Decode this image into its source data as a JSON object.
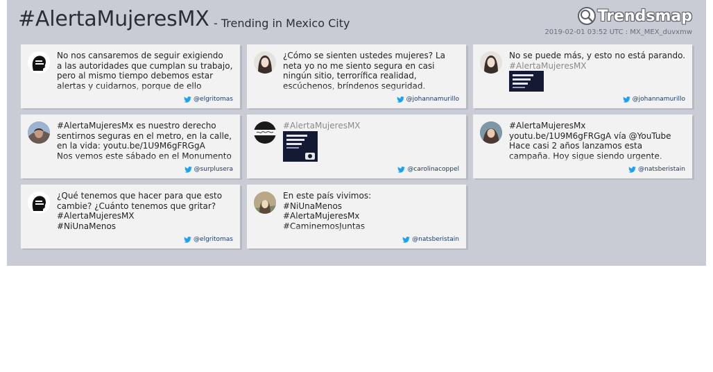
{
  "header": {
    "title": "#AlertaMujeresMX",
    "subtitle": "- Trending in Mexico City",
    "logo_text": "Trendsmap",
    "meta": "2019-02-01 03:52 UTC : MX_MEX_duvxmw"
  },
  "tweets": [
    {
      "lines": [
        "No nos cansaremos de seguir exigiendo",
        "a las autoridades que cumplan su trabajo,",
        "pero al mismo tiempo debemos estar",
        "alertas y cuidarnos, porque de ello"
      ],
      "user": "@elgritomas",
      "avatar_icon": "head-silhouette-icon"
    },
    {
      "lines": [
        "¿Cómo se sienten ustedes mujeres? La",
        "neta yo no me siento segura en casi",
        "ningún sitio, terrorífica realidad,",
        "escúchenos, bríndenos seguridad."
      ],
      "user": "@johannamurillo",
      "avatar_icon": "portrait-avatar"
    },
    {
      "lines": [
        "No se puede más, y esto no está parando.",
        "#AlertaMujeresMX"
      ],
      "user": "@johannamurillo",
      "avatar_icon": "portrait-avatar"
    },
    {
      "lines": [
        "#AlertaMujeresMx es nuestro derecho",
        "sentirnos seguras en el metro, en la calle,",
        "en la vida: youtu.be/1U9M6gFRGgA",
        "Nos vemos este sábado en el Monumento"
      ],
      "user": "@surplusera",
      "avatar_icon": "portrait-avatar"
    },
    {
      "lines": [
        "#AlertaMujeresMX"
      ],
      "user": "@carolinacoppel",
      "avatar_icon": "signature-avatar"
    },
    {
      "lines": [
        "#AlertaMujeresMx",
        "youtu.be/1U9M6gFRGgA vía @YouTube",
        "Hace casi 2 años lanzamos esta",
        "campaña. Hoy sigue siendo urgente."
      ],
      "user": "@natsberistain",
      "avatar_icon": "portrait-avatar"
    },
    {
      "lines": [
        "¿Qué tenemos que hacer para que esto",
        "cambie? ¿Cuánto tenemos que gritar?",
        "#AlertaMujeresMX",
        "#NiUnaMenos"
      ],
      "user": "@elgritomas",
      "avatar_icon": "head-silhouette-icon"
    },
    {
      "lines": [
        "En este país vivimos:",
        "#NiUnaMenos",
        "#AlertaMujeresMx",
        "#CaminemosJuntas"
      ],
      "user": "@natsberistain",
      "avatar_icon": "portrait-avatar"
    }
  ],
  "colors": {
    "panel_bg": "#c9ccd4",
    "card_bg": "#f2f2f2",
    "twitter_blue": "#1da1f2",
    "handle_text": "#1a3a6a",
    "tweet_text": "#222222"
  }
}
